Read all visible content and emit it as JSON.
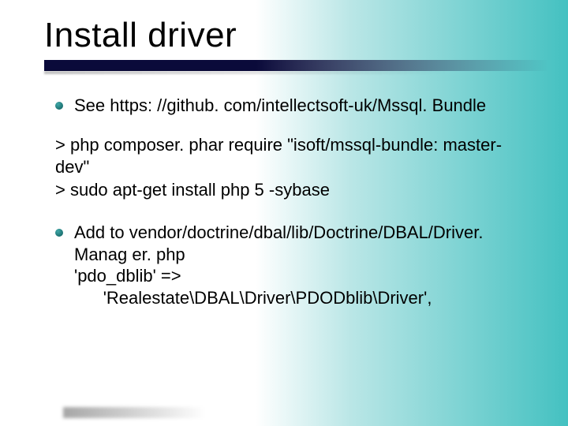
{
  "title": "Install driver",
  "bullets": [
    {
      "text": "See https: //github. com/intellectsoft-uk/Mssql. Bundle"
    },
    {
      "text": "Add to vendor/doctrine/dbal/lib/Doctrine/DBAL/Driver. Manag er. php\n'pdo_dblib' =>\n      'Realestate\\DBAL\\Driver\\PDODblib\\Driver',"
    }
  ],
  "code": "> php composer. phar require \"isoft/mssql-bundle: master-dev\"\n> sudo apt-get install php 5 -sybase"
}
